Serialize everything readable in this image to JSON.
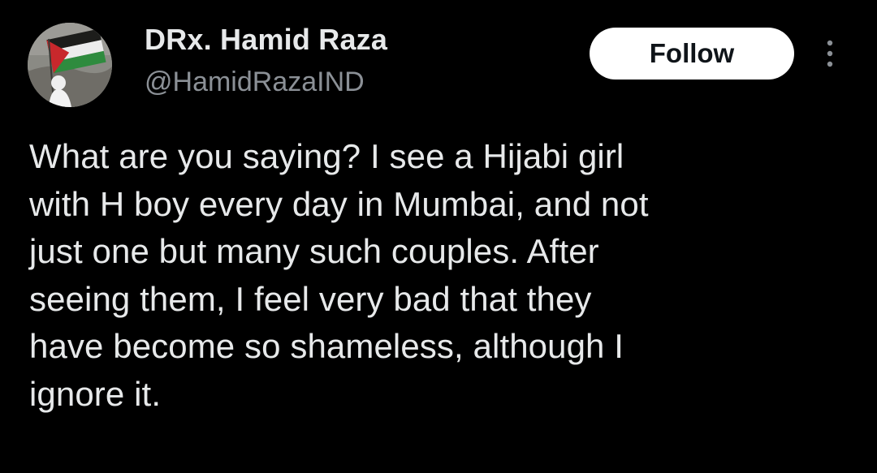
{
  "author": {
    "display_name": "DRx. Hamid Raza",
    "handle": "@HamidRazaIND",
    "avatar_icon": "profile-avatar-flag"
  },
  "actions": {
    "follow_label": "Follow",
    "more_icon": "more-options-icon"
  },
  "tweet": {
    "text": "What are you saying? I see a Hijabi girl\nwith H boy every day in Mumbai, and not\njust one but many such couples. After\nseeing them, I feel very bad that they\nhave become so shameless, although I\nignore it."
  },
  "colors": {
    "background": "#000000",
    "text_primary": "#e7e9ea",
    "text_secondary": "#8b9096",
    "button_bg": "#ffffff",
    "button_text": "#0f1419"
  }
}
